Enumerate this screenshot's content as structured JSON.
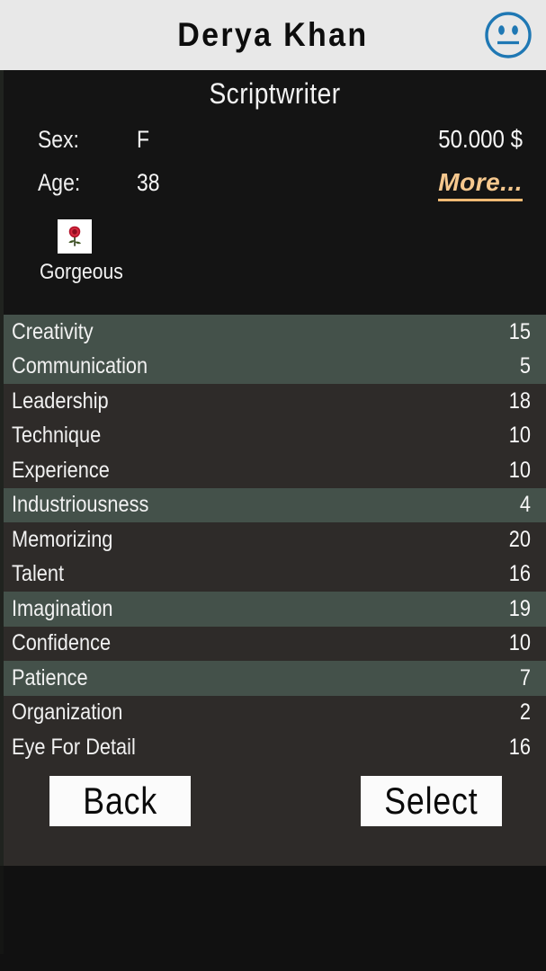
{
  "titlebar": {
    "character_name": "Derya Khan",
    "mood_icon": "neutral-face-icon",
    "mood_icon_color": "#1f78b4",
    "background_color": "#e8e8e8"
  },
  "info": {
    "role": "Scriptwriter",
    "sex_label": "Sex:",
    "sex_value": "F",
    "age_label": "Age:",
    "age_value": "38",
    "money": "50.000 $",
    "more_label": "More...",
    "more_color": "#f6c88e",
    "trait_icon": "rose-icon",
    "trait_label": "Gorgeous"
  },
  "stats": {
    "rows": [
      {
        "name": "Creativity",
        "value": "15",
        "band": "g"
      },
      {
        "name": "Communication",
        "value": "5",
        "band": "g"
      },
      {
        "name": "Leadership",
        "value": "18",
        "band": "d"
      },
      {
        "name": "Technique",
        "value": "10",
        "band": "d"
      },
      {
        "name": "Experience",
        "value": "10",
        "band": "d"
      },
      {
        "name": "Industriousness",
        "value": "4",
        "band": "g"
      },
      {
        "name": "Memorizing",
        "value": "20",
        "band": "d"
      },
      {
        "name": "Talent",
        "value": "16",
        "band": "d"
      },
      {
        "name": "Imagination",
        "value": "19",
        "band": "g"
      },
      {
        "name": "Confidence",
        "value": "10",
        "band": "d"
      },
      {
        "name": "Patience",
        "value": "7",
        "band": "g"
      },
      {
        "name": "Organization",
        "value": "2",
        "band": "d"
      },
      {
        "name": "Eye For Detail",
        "value": "16",
        "band": "d"
      }
    ],
    "band_color_highlight": "#44514a",
    "band_color_normal": "#2e2b29"
  },
  "footer": {
    "back_label": "Back",
    "select_label": "Select"
  }
}
